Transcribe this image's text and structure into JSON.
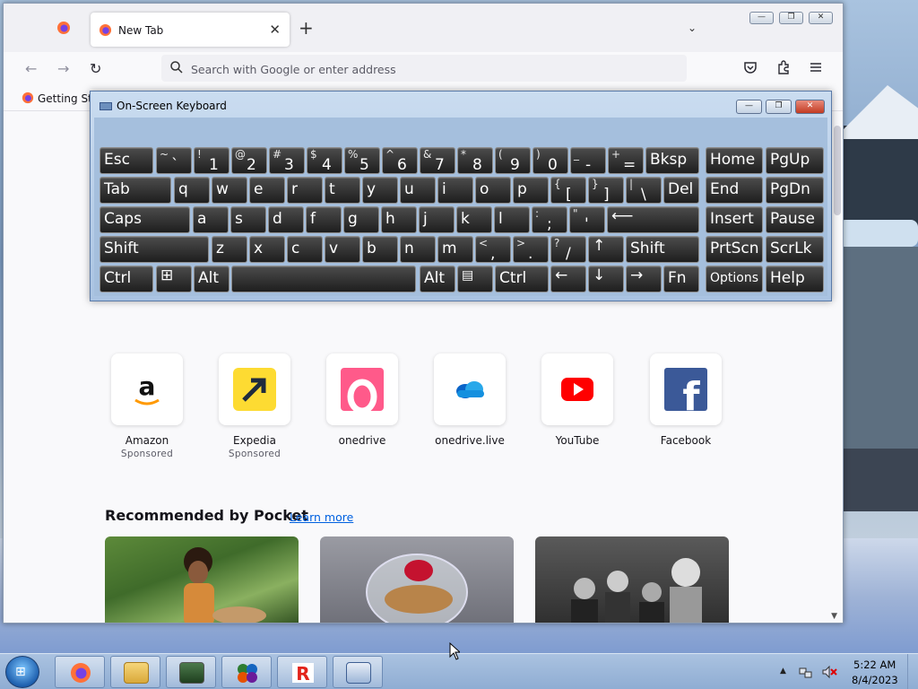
{
  "browser": {
    "tab_title": "New Tab",
    "tab_close": "✕",
    "new_tab": "+",
    "tab_list": "⌄",
    "url_placeholder": "Search with Google or enter address",
    "bookmark_label": "Getting Started",
    "caption_buttons": {
      "minimize": "—",
      "maximize": "❐",
      "close": "✕"
    }
  },
  "top_sites": [
    {
      "name": "Amazon",
      "sub": "Sponsored",
      "icon": "amazon-icon"
    },
    {
      "name": "Expedia",
      "sub": "Sponsored",
      "icon": "expedia-icon"
    },
    {
      "name": "onedrive",
      "sub": "",
      "icon": "onedrive-o-icon"
    },
    {
      "name": "onedrive.live",
      "sub": "",
      "icon": "onedrive-cloud-icon"
    },
    {
      "name": "YouTube",
      "sub": "",
      "icon": "youtube-icon"
    },
    {
      "name": "Facebook",
      "sub": "",
      "icon": "facebook-icon"
    }
  ],
  "pocket": {
    "heading": "Recommended by Pocket",
    "learn_more": "Learn more"
  },
  "osk": {
    "title": "On-Screen Keyboard",
    "caption_buttons": {
      "minimize": "—",
      "maximize": "❐",
      "close": "✕"
    },
    "keys": {
      "esc": "Esc",
      "tilde_shift": "~",
      "tilde": "`",
      "n1s": "!",
      "n1": "1",
      "n2s": "@",
      "n2": "2",
      "n3s": "#",
      "n3": "3",
      "n4s": "$",
      "n4": "4",
      "n5s": "%",
      "n5": "5",
      "n6s": "^",
      "n6": "6",
      "n7s": "&",
      "n7": "7",
      "n8s": "*",
      "n8": "8",
      "n9s": "(",
      "n9": "9",
      "n0s": ")",
      "n0": "0",
      "minus_s": "_",
      "minus": "-",
      "eq_s": "+",
      "eq": "=",
      "bksp": "Bksp",
      "home": "Home",
      "pgup": "PgUp",
      "tab": "Tab",
      "q": "q",
      "w": "w",
      "e": "e",
      "r": "r",
      "t": "t",
      "y": "y",
      "u": "u",
      "i": "i",
      "o": "o",
      "p": "p",
      "lb_s": "{",
      "lb": "[",
      "rb_s": "}",
      "rb": "]",
      "bs_s": "|",
      "bs": "\\",
      "del": "Del",
      "end": "End",
      "pgdn": "PgDn",
      "caps": "Caps",
      "a": "a",
      "s": "s",
      "d": "d",
      "f": "f",
      "g": "g",
      "h": "h",
      "j": "j",
      "k": "k",
      "l": "l",
      "semi_s": ":",
      "semi": ";",
      "quote_s": "\"",
      "quote": "'",
      "enter": "⟵",
      "insert": "Insert",
      "pause": "Pause",
      "shift": "Shift",
      "z": "z",
      "x": "x",
      "c": "c",
      "v": "v",
      "b": "b",
      "n": "n",
      "m": "m",
      "comma_s": "<",
      "comma": ",",
      "period_s": ">",
      "period": ".",
      "slash_s": "?",
      "slash": "/",
      "up": "↑",
      "rshift": "Shift",
      "prtscn": "PrtScn",
      "scrlk": "ScrLk",
      "ctrl": "Ctrl",
      "win": "⊞",
      "alt": "Alt",
      "space": "",
      "ralt": "Alt",
      "menu": "▤",
      "rctrl": "Ctrl",
      "left": "←",
      "down": "↓",
      "right": "→",
      "fn": "Fn",
      "options": "Options",
      "help": "Help"
    }
  },
  "taskbar": {
    "start_glyph": "⊞",
    "apps": [
      "firefox-icon",
      "file-explorer-icon",
      "system-monitor-icon",
      "office-icon",
      "roblox-icon",
      "on-screen-keyboard-icon"
    ],
    "time": "5:22 AM",
    "date": "8/4/2023"
  }
}
